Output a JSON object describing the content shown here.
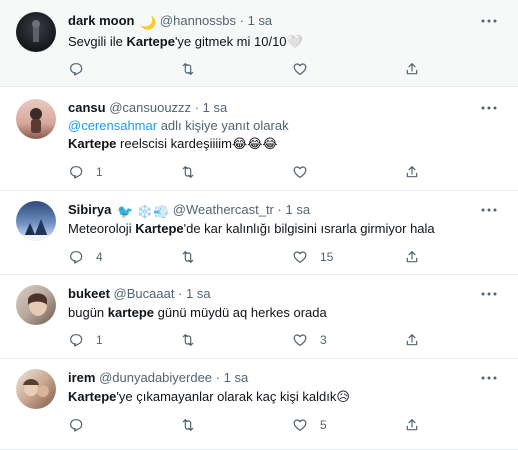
{
  "tweets": [
    {
      "name": "dark moon",
      "name_emoji": "🌙",
      "handle": "@hannossbs",
      "dot": "·",
      "time": "1 sa",
      "text_parts": [
        "Sevgili ile ",
        "Kartepe",
        "'ye gitmek mi 10/10"
      ],
      "text_emoji": "🤍",
      "replies": "",
      "retweets": "",
      "likes": ""
    },
    {
      "name": "cansu",
      "handle": "@cansuouzzz",
      "dot": "·",
      "time": "1 sa",
      "reply_to_mention": "@cerensahmar",
      "reply_to_suffix": " adlı kişiye yanıt olarak",
      "text_parts": [
        "Kartepe",
        " reelscisi kardeşiiiim"
      ],
      "text_emoji": "😂😂😂",
      "replies": "1",
      "retweets": "",
      "likes": ""
    },
    {
      "name": "Sibirya",
      "name_emoji": "🐦 ❄️💨",
      "handle": "@Weathercast_tr",
      "dot": "·",
      "time": "1 sa",
      "text_parts": [
        "Meteoroloji ",
        "Kartepe",
        "'de kar kalınlığı bilgisini ısrarla girmiyor hala"
      ],
      "replies": "4",
      "retweets": "",
      "likes": "15"
    },
    {
      "name": "bukeet",
      "handle": "@Bucaaat",
      "dot": "·",
      "time": "1 sa",
      "text_parts": [
        "bugün ",
        "kartepe",
        " günü müydü aq herkes orada"
      ],
      "replies": "1",
      "retweets": "",
      "likes": "3"
    },
    {
      "name": "irem",
      "handle": "@dunyadabiyerdee",
      "dot": "·",
      "time": "1 sa",
      "text_parts": [
        "Kartepe",
        "'ye çıkamayanlar olarak kaç kişi kaldık"
      ],
      "text_emoji": "😥",
      "replies": "",
      "retweets": "",
      "likes": "5"
    }
  ],
  "icons": {
    "more": "more-horizontal-icon",
    "reply": "reply-icon",
    "retweet": "retweet-icon",
    "like": "heart-icon",
    "share": "share-icon"
  },
  "colors": {
    "text": "#0f1419",
    "secondary": "#536471",
    "mention": "#1d9bf0",
    "divider": "#e6ecf0",
    "highlight_bg": "#f7f9f9"
  }
}
